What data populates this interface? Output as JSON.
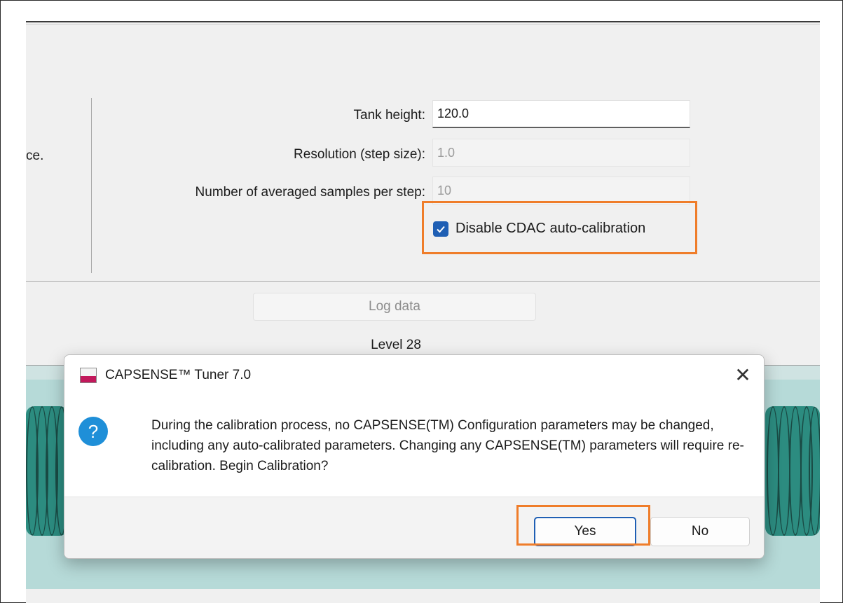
{
  "partial_label": "ce.",
  "form": {
    "tank_height_label": "Tank height:",
    "tank_height_value": "120.0",
    "resolution_label": "Resolution (step size):",
    "resolution_value": "1.0",
    "samples_label": "Number of averaged samples per step:",
    "samples_value": "10",
    "cdac_checkbox_label": "Disable CDAC auto-calibration",
    "cdac_checked": true
  },
  "log_button_label": "Log data",
  "level_text": "Level 28",
  "dialog": {
    "title": "CAPSENSE™ Tuner 7.0",
    "close_symbol": "✕",
    "icon_symbol": "?",
    "message": "During the calibration process, no CAPSENSE(TM) Configuration parameters may be changed, including any auto-calibrated parameters. Changing any CAPSENSE(TM) parameters will require re-calibration. Begin Calibration?",
    "yes_label": "Yes",
    "no_label": "No"
  },
  "colors": {
    "highlight": "#ef7d2a",
    "accent": "#1f5fb4",
    "question_icon": "#1f8fd8",
    "teal": "#2c8c80"
  }
}
